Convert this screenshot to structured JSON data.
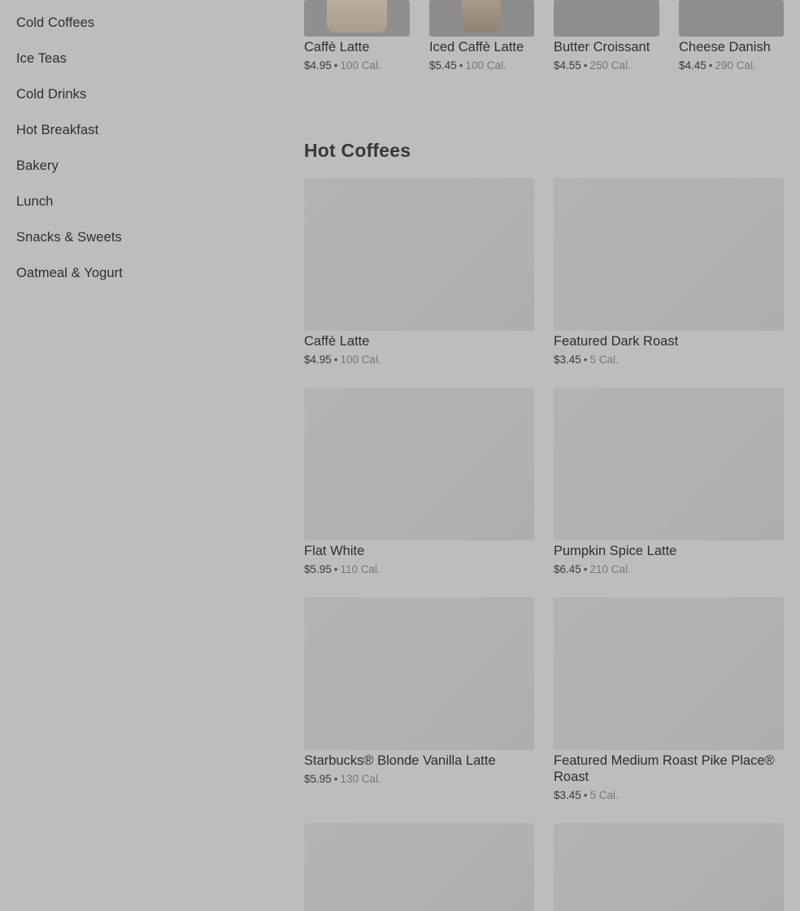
{
  "sidebar": {
    "items": [
      {
        "label": "Cold Coffees"
      },
      {
        "label": "Ice Teas"
      },
      {
        "label": "Cold Drinks"
      },
      {
        "label": "Hot Breakfast"
      },
      {
        "label": "Bakery"
      },
      {
        "label": "Lunch"
      },
      {
        "label": "Snacks & Sweets"
      },
      {
        "label": "Oatmeal & Yogurt"
      }
    ]
  },
  "featured": {
    "items": [
      {
        "name": "Caffè Latte",
        "price": "$4.95",
        "separator": "•",
        "calories": "100 Cal."
      },
      {
        "name": "Iced Caffè Latte",
        "price": "$5.45",
        "separator": "•",
        "calories": "100 Cal."
      },
      {
        "name": "Butter Croissant",
        "price": "$4.55",
        "separator": "•",
        "calories": "250 Cal."
      },
      {
        "name": "Cheese Danish",
        "price": "$4.45",
        "separator": "•",
        "calories": "290 Cal."
      }
    ]
  },
  "hot_coffees": {
    "title": "Hot Coffees",
    "items": [
      {
        "name": "Caffè Latte",
        "price": "$4.95",
        "separator": "•",
        "calories": "100 Cal."
      },
      {
        "name": "Featured Dark Roast",
        "price": "$3.45",
        "separator": "•",
        "calories": "5 Cal."
      },
      {
        "name": "Flat White",
        "price": "$5.95",
        "separator": "•",
        "calories": "110 Cal."
      },
      {
        "name": "Pumpkin Spice Latte",
        "price": "$6.45",
        "separator": "•",
        "calories": "210 Cal."
      },
      {
        "name": "Starbucks® Blonde Vanilla Latte",
        "price": "$5.95",
        "separator": "•",
        "calories": "130 Cal."
      },
      {
        "name": "Featured Medium Roast Pike Place® Roast",
        "price": "$3.45",
        "separator": "•",
        "calories": "5 Cal."
      }
    ]
  },
  "colors": {
    "overlay_background": "#bdbdbd",
    "text_primary": "#2f2f2f",
    "image_placeholder": "#b1b1b1"
  }
}
